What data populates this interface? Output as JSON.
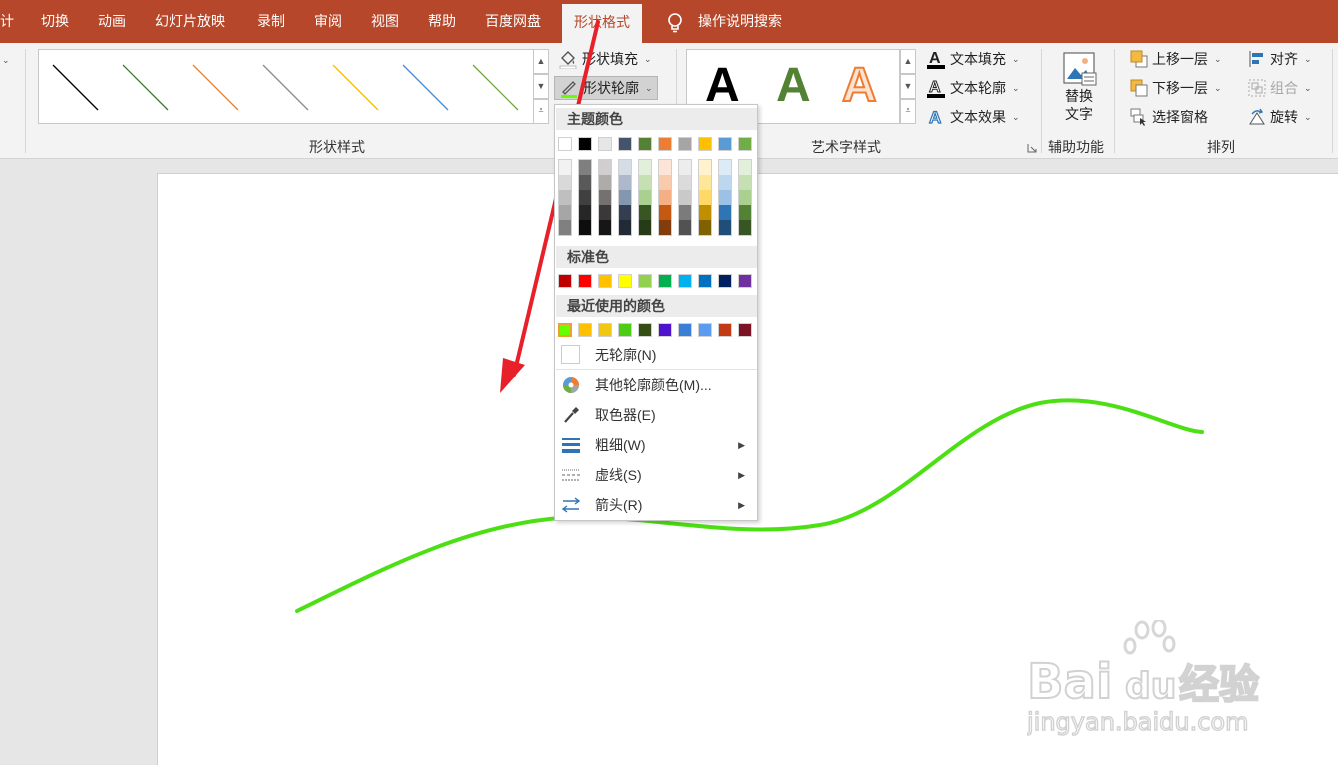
{
  "tabs": [
    {
      "label": "计"
    },
    {
      "label": "切换"
    },
    {
      "label": "动画"
    },
    {
      "label": "幻灯片放映"
    },
    {
      "label": "录制"
    },
    {
      "label": "审阅"
    },
    {
      "label": "视图"
    },
    {
      "label": "帮助"
    },
    {
      "label": "百度网盘"
    },
    {
      "label": "形状格式"
    }
  ],
  "search": {
    "label": "操作说明搜索"
  },
  "ribbon": {
    "shape_styles": {
      "group_label": "形状样式",
      "line_colors": [
        "#000000",
        "#3a7a2a",
        "#e8822e",
        "#8c8c8c",
        "#f2c200",
        "#4a8ad6",
        "#6aaa3a"
      ],
      "fill": "形状填充",
      "outline": "形状轮廓"
    },
    "wordart": {
      "group_label": "艺术字样式",
      "samples": [
        {
          "char": "A",
          "color": "#000000"
        },
        {
          "char": "A",
          "color": "#548235"
        },
        {
          "char": "A",
          "color": "#ed7d31"
        }
      ],
      "text_fill": "文本填充",
      "text_outline": "文本轮廓",
      "text_effect": "文本效果"
    },
    "accessibility": {
      "group_label": "辅助功能",
      "alt_text_line1": "替换",
      "alt_text_line2": "文字"
    },
    "arrange": {
      "group_label": "排列",
      "bring_forward": "上移一层",
      "send_backward": "下移一层",
      "selection_pane": "选择窗格",
      "align": "对齐",
      "group": "组合",
      "rotate": "旋转"
    }
  },
  "outline_menu": {
    "theme_colors_title": "主题颜色",
    "theme_colors": [
      [
        "#ffffff",
        "#f2f2f2",
        "#d9d9d9",
        "#bfbfbf",
        "#a6a6a6",
        "#808080"
      ],
      [
        "#000000",
        "#7f7f7f",
        "#595959",
        "#404040",
        "#262626",
        "#0d0d0d"
      ],
      [
        "#e7e6e6",
        "#d0cece",
        "#aeabab",
        "#757171",
        "#3a3838",
        "#171616"
      ],
      [
        "#44546a",
        "#d6dce5",
        "#adb9ca",
        "#8497b0",
        "#333f50",
        "#222a35"
      ],
      [
        "#548235",
        "#e2efda",
        "#c6e0b4",
        "#a9d08e",
        "#375623",
        "#263c18"
      ],
      [
        "#ed7d31",
        "#fce4d6",
        "#f8cbad",
        "#f4b084",
        "#c65911",
        "#833c0c"
      ],
      [
        "#a5a5a5",
        "#ededed",
        "#dbdbdb",
        "#c9c9c9",
        "#7b7b7b",
        "#525252"
      ],
      [
        "#ffc000",
        "#fff2cc",
        "#ffe699",
        "#ffd966",
        "#bf8f00",
        "#806000"
      ],
      [
        "#5b9bd5",
        "#ddebf7",
        "#bdd7ee",
        "#9bc2e6",
        "#2f75b5",
        "#1f4e78"
      ],
      [
        "#70ad47",
        "#e2efda",
        "#c6e0b4",
        "#a9d08e",
        "#548235",
        "#375623"
      ]
    ],
    "standard_colors_title": "标准色",
    "standard_colors": [
      "#c00000",
      "#ff0000",
      "#ffc000",
      "#ffff00",
      "#92d050",
      "#00b050",
      "#00b0f0",
      "#0070c0",
      "#002060",
      "#7030a0"
    ],
    "recent_colors_title": "最近使用的颜色",
    "recent_colors": [
      "#66ff00",
      "#ffc000",
      "#f0c814",
      "#4ccc14",
      "#334d14",
      "#4d14cc",
      "#3a7fd5",
      "#5b9bf0",
      "#c23b14",
      "#7a1424"
    ],
    "no_outline": "无轮廓(N)",
    "more_colors": "其他轮廓颜色(M)...",
    "eyedropper": "取色器(E)",
    "weight": "粗细(W)",
    "dashes": "虚线(S)",
    "arrows": "箭头(R)"
  },
  "watermark": {
    "brand": "Bai du 经验",
    "url": "jingyan.baidu.com"
  }
}
